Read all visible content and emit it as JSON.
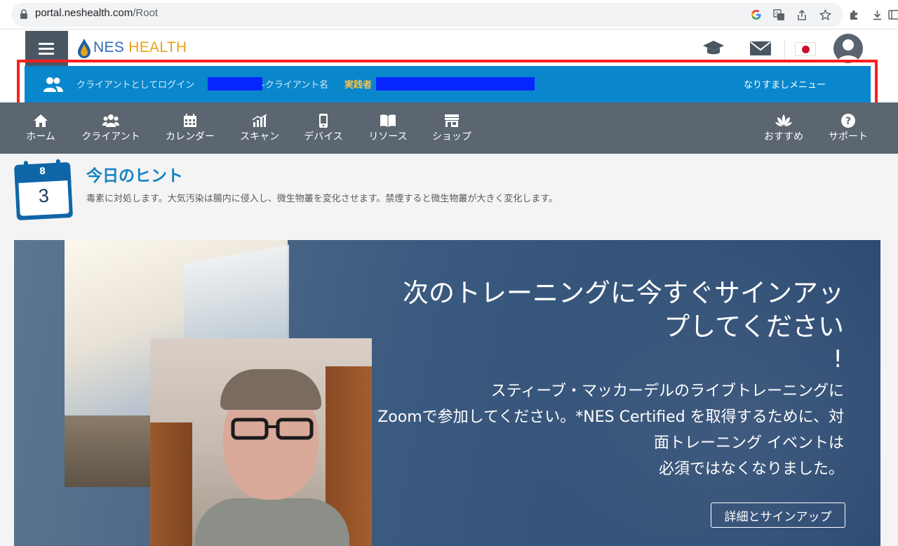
{
  "browser": {
    "url_host": "portal.neshealth.com",
    "url_path": "/Root",
    "icons": [
      "google-icon",
      "translate-icon",
      "share-icon",
      "star-icon",
      "extensions-icon",
      "download-icon"
    ]
  },
  "header": {
    "logo_nes": "NES",
    "logo_health": "HEALTH",
    "icons": [
      "graduation-cap-icon",
      "mail-icon",
      "japan-flag-icon",
      "user-avatar-icon"
    ]
  },
  "impersonation": {
    "text_prefix": "クライアントとしてログイン",
    "text_mid": "-クライアント名",
    "role": "実践者",
    "menu_label": "なりすましメニュー"
  },
  "nav": {
    "items": [
      {
        "label": "ホーム",
        "icon": "home-icon"
      },
      {
        "label": "クライアント",
        "icon": "users-icon"
      },
      {
        "label": "カレンダー",
        "icon": "calendar-icon"
      },
      {
        "label": "スキャン",
        "icon": "scan-chart-icon"
      },
      {
        "label": "デバイス",
        "icon": "device-icon"
      },
      {
        "label": "リソース",
        "icon": "book-icon"
      },
      {
        "label": "ショップ",
        "icon": "shop-icon"
      },
      {
        "label": "おすすめ",
        "icon": "lotus-icon"
      },
      {
        "label": "サポート",
        "icon": "help-icon"
      }
    ]
  },
  "hint": {
    "month": "8",
    "day": "3",
    "title": "今日のヒント",
    "text": "毒素に対処します。大気汚染は腸内に侵入し、微生物叢を変化させます。禁煙すると微生物叢が大きく変化します。"
  },
  "banner": {
    "title_line1": "次のトレーニングに今すぐサインアッ",
    "title_line2": "プしてください",
    "title_bang": "!",
    "body_line1": "スティーブ・マッカーデルのライブトレーニングに",
    "body_line2": "Zoomで参加してください。*NES Certified を取得するために、対",
    "body_line3": "面トレーニング イベントは",
    "body_line4": "必須ではなくなりました。",
    "button_label": "詳細とサインアップ"
  }
}
